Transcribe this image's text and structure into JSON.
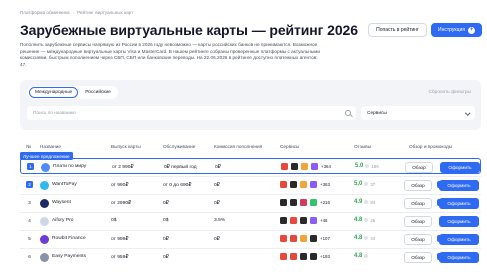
{
  "breadcrumbs": [
    "Платформа обменника",
    "Рейтинг виртуальных карт"
  ],
  "title": "Зарубежные виртуальные карты — рейтинг 2026",
  "buttons": {
    "add_to_rating": "Попасть в рейтинг",
    "guide": "Инструкция"
  },
  "description": "Пополнить зарубежные сервисы напрямую из России в 2026 году невозможно — карты российских банков не принимаются. Возможное решение — международные виртуальные карты Visa и MasterCard. В нашем рейтинге собраны проверенные платформы с актуальными комиссиями, быстрым пополнением через СБП, СБП или банковские переводы. На 22.06.2026 в рейтинге доступно платежных агентов: 47.",
  "filters": {
    "tabs": [
      "Международные",
      "Российские"
    ],
    "active_tab": 0,
    "reset_label": "Сбросить фильтры",
    "search_placeholder": "Поиск по названию",
    "services_label": "Сервисы"
  },
  "table": {
    "headers": [
      "№",
      "Название",
      "Выпуск карты",
      "Обслуживание",
      "Комиссия пополнения",
      "Сервисы",
      "Отзывы",
      "Обзор и промокоды"
    ],
    "best_badge": "Лучшее предложение",
    "review_label": "Обзор",
    "order_label": "Оформить",
    "rows": [
      {
        "num": "1",
        "name": "Плати по миру",
        "issue": "от 2 990₽",
        "service": "0₽ первый год",
        "topup": "0₽",
        "more": "+364",
        "score": "5.0",
        "reviews": "186",
        "logo_color": "#4f8df5",
        "svc_colors": [
          "#e8473b",
          "#2a2a2a",
          "#f0a43a",
          "#8a5cf5"
        ],
        "promo": false
      },
      {
        "num": "2",
        "name": "WantToPay",
        "issue": "от 990₽",
        "service": "от 0 до 690₽",
        "topup": "0₽",
        "more": "+363",
        "score": "5.0",
        "reviews": "37",
        "logo_color": "#2db8f0",
        "svc_colors": [
          "#e8473b",
          "#2a2a2a",
          "#f0a43a",
          "#8a5cf5"
        ],
        "promo": true
      },
      {
        "num": "3",
        "name": "Waysent",
        "issue": "от 2990₽",
        "service": "0₽",
        "topup": "0₽",
        "more": "+216",
        "score": "4.9",
        "reviews": "84",
        "logo_color": "#1e2a66",
        "svc_colors": [
          "#2a2a2a",
          "#2a2a2a",
          "#d33a5e",
          "#35c26b"
        ],
        "promo": true
      },
      {
        "num": "4",
        "name": "Aifory Pro",
        "issue": "0$",
        "service": "0$",
        "topup": "3.5%",
        "more": "+46",
        "score": "4.8",
        "reviews": "26",
        "logo_color": "#cfd6e6",
        "svc_colors": [
          "#2a2a2a",
          "#e8473b",
          "#2a2a2a",
          "#8a5cf5"
        ],
        "promo": false
      },
      {
        "num": "5",
        "name": "Rowbit Finance",
        "issue": "от 999₽",
        "service": "0₽",
        "topup": "0₽",
        "more": "+107",
        "score": "4.8",
        "reviews": "44",
        "logo_color": "#6f3bd8",
        "svc_colors": [
          "#e8473b",
          "#e8473b",
          "#f0a43a",
          "#2a2a2a"
        ],
        "promo": true
      },
      {
        "num": "6",
        "name": "Easy Payments",
        "issue": "от 959₽",
        "service": "0₽",
        "topup": "",
        "more": "+193",
        "score": "4.8",
        "reviews": "",
        "logo_color": "#8a93a6",
        "svc_colors": [
          "#e8473b",
          "#e8473b",
          "#2a2a2a",
          "#2a2a2a"
        ],
        "promo": true
      }
    ]
  }
}
